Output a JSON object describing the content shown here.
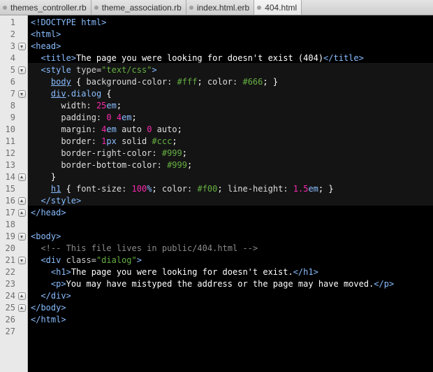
{
  "tabs": [
    {
      "label": "themes_controller.rb",
      "active": false
    },
    {
      "label": "theme_association.rb",
      "active": false
    },
    {
      "label": "index.html.erb",
      "active": false
    },
    {
      "label": "404.html",
      "active": true
    }
  ],
  "gutter": {
    "line_numbers": [
      "1",
      "2",
      "3",
      "4",
      "5",
      "6",
      "7",
      "8",
      "9",
      "10",
      "11",
      "12",
      "13",
      "14",
      "15",
      "16",
      "17",
      "18",
      "19",
      "20",
      "21",
      "22",
      "23",
      "24",
      "25",
      "26",
      "27"
    ],
    "fold_markers": {
      "3": "down",
      "5": "down",
      "7": "down",
      "14": "up",
      "16": "up",
      "17": "up",
      "19": "down",
      "21": "down",
      "24": "up",
      "25": "up"
    }
  },
  "colors": {
    "tag": "#89bdff",
    "string": "#65b042",
    "number": "#f92aad",
    "comment": "#8a8a8a",
    "text": "#ffffff",
    "background": "#000000",
    "head_highlight": "#141414"
  },
  "code_lines": [
    [
      [
        "t",
        "<!DOCTYPE html>"
      ]
    ],
    [
      [
        "t",
        "<html>"
      ]
    ],
    [
      [
        "t",
        "<head>"
      ]
    ],
    [
      [
        "w",
        "  "
      ],
      [
        "t",
        "<title>"
      ],
      [
        "w",
        "The page you were looking for doesn't exist (404)"
      ],
      [
        "t",
        "</title>"
      ]
    ],
    [
      [
        "w",
        "  "
      ],
      [
        "t",
        "<style"
      ],
      [
        "a",
        " type"
      ],
      [
        "p",
        "="
      ],
      [
        "s",
        "\"text/css\""
      ],
      [
        "t",
        ">"
      ]
    ],
    [
      [
        "w",
        "    "
      ],
      [
        "u",
        "body"
      ],
      [
        "w",
        " { "
      ],
      [
        "p",
        "background-color: "
      ],
      [
        "v",
        "#fff"
      ],
      [
        "w",
        "; "
      ],
      [
        "p",
        "color: "
      ],
      [
        "v",
        "#666"
      ],
      [
        "w",
        "; }"
      ]
    ],
    [
      [
        "w",
        "    "
      ],
      [
        "u",
        "div"
      ],
      [
        "t",
        ".dialog"
      ],
      [
        "w",
        " {"
      ]
    ],
    [
      [
        "w",
        "      "
      ],
      [
        "p",
        "width: "
      ],
      [
        "n",
        "25"
      ],
      [
        "t",
        "em"
      ],
      [
        "w",
        ";"
      ]
    ],
    [
      [
        "w",
        "      "
      ],
      [
        "p",
        "padding: "
      ],
      [
        "n",
        "0 4"
      ],
      [
        "t",
        "em"
      ],
      [
        "w",
        ";"
      ]
    ],
    [
      [
        "w",
        "      "
      ],
      [
        "p",
        "margin: "
      ],
      [
        "n",
        "4"
      ],
      [
        "t",
        "em"
      ],
      [
        "p",
        " auto "
      ],
      [
        "n",
        "0"
      ],
      [
        "p",
        " auto"
      ],
      [
        "w",
        ";"
      ]
    ],
    [
      [
        "w",
        "      "
      ],
      [
        "p",
        "border: "
      ],
      [
        "n",
        "1"
      ],
      [
        "t",
        "px"
      ],
      [
        "p",
        " solid "
      ],
      [
        "v",
        "#ccc"
      ],
      [
        "w",
        ";"
      ]
    ],
    [
      [
        "w",
        "      "
      ],
      [
        "p",
        "border-right-color: "
      ],
      [
        "v",
        "#999"
      ],
      [
        "w",
        ";"
      ]
    ],
    [
      [
        "w",
        "      "
      ],
      [
        "p",
        "border-bottom-color: "
      ],
      [
        "v",
        "#999"
      ],
      [
        "w",
        ";"
      ]
    ],
    [
      [
        "w",
        "    }"
      ]
    ],
    [
      [
        "w",
        "    "
      ],
      [
        "u",
        "h1"
      ],
      [
        "w",
        " { "
      ],
      [
        "p",
        "font-size: "
      ],
      [
        "n",
        "100"
      ],
      [
        "t",
        "%"
      ],
      [
        "w",
        "; "
      ],
      [
        "p",
        "color: "
      ],
      [
        "v",
        "#f00"
      ],
      [
        "w",
        "; "
      ],
      [
        "p",
        "line-height: "
      ],
      [
        "n",
        "1.5"
      ],
      [
        "t",
        "em"
      ],
      [
        "w",
        "; }"
      ]
    ],
    [
      [
        "w",
        "  "
      ],
      [
        "t",
        "</style>"
      ]
    ],
    [
      [
        "t",
        "</head>"
      ]
    ],
    [],
    [
      [
        "t",
        "<body>"
      ]
    ],
    [
      [
        "w",
        "  "
      ],
      [
        "c",
        "<!-- This file lives in public/404.html -->"
      ]
    ],
    [
      [
        "w",
        "  "
      ],
      [
        "t",
        "<div"
      ],
      [
        "a",
        " class"
      ],
      [
        "p",
        "="
      ],
      [
        "s",
        "\"dialog\""
      ],
      [
        "t",
        ">"
      ]
    ],
    [
      [
        "w",
        "    "
      ],
      [
        "t",
        "<h1>"
      ],
      [
        "w",
        "The page you were looking for doesn't exist."
      ],
      [
        "t",
        "</h1>"
      ]
    ],
    [
      [
        "w",
        "    "
      ],
      [
        "t",
        "<p>"
      ],
      [
        "w",
        "You may have mistyped the address or the page may have moved."
      ],
      [
        "t",
        "</p>"
      ]
    ],
    [
      [
        "w",
        "  "
      ],
      [
        "t",
        "</div>"
      ]
    ],
    [
      [
        "t",
        "</body>"
      ]
    ],
    [
      [
        "t",
        "</html>"
      ]
    ],
    []
  ]
}
